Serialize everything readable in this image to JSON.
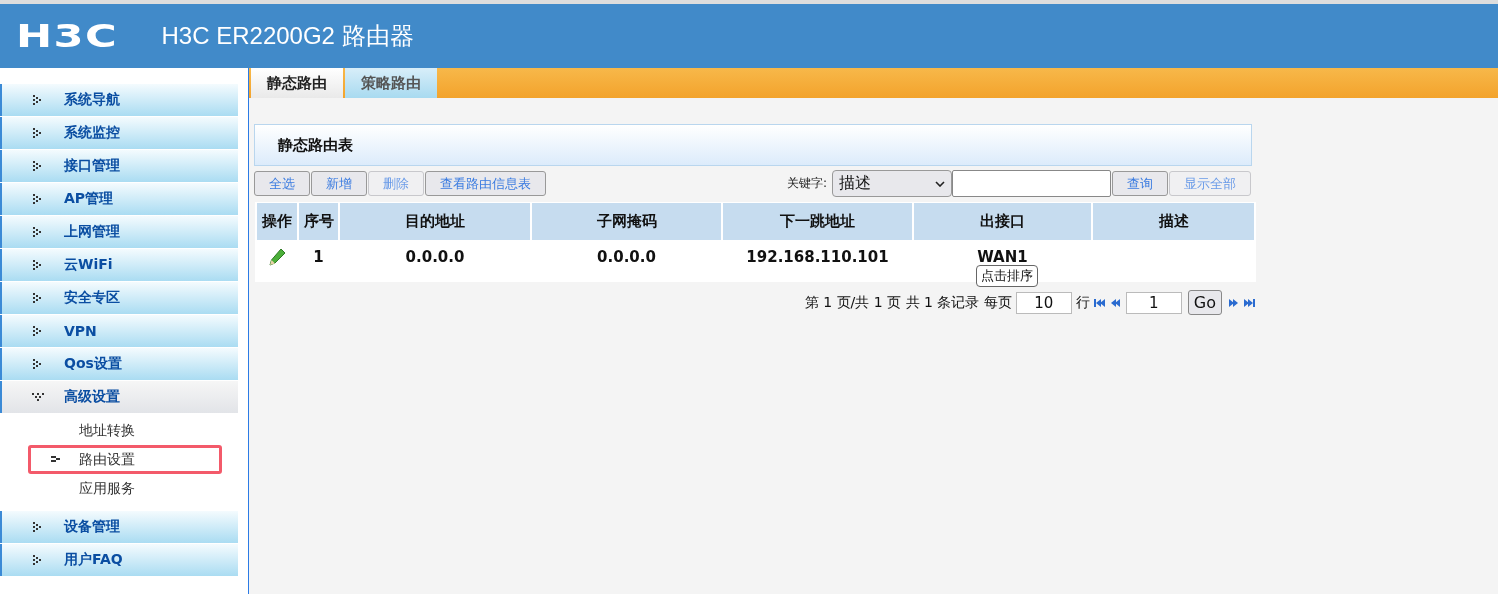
{
  "header": {
    "logo": "H3C",
    "title": "H3C ER2200G2 路由器"
  },
  "tabs": [
    {
      "label": "静态路由",
      "selected": true
    },
    {
      "label": "策略路由",
      "selected": false
    }
  ],
  "sidebar": {
    "items": [
      {
        "label": "系统导航",
        "expanded": false
      },
      {
        "label": "系统监控",
        "expanded": false
      },
      {
        "label": "接口管理",
        "expanded": false
      },
      {
        "label": "AP管理",
        "expanded": false
      },
      {
        "label": "上网管理",
        "expanded": false
      },
      {
        "label": "云WiFi",
        "expanded": false
      },
      {
        "label": "安全专区",
        "expanded": false
      },
      {
        "label": "VPN",
        "expanded": false
      },
      {
        "label": "Qos设置",
        "expanded": false
      },
      {
        "label": "高级设置",
        "expanded": true,
        "children": [
          {
            "label": "地址转换",
            "selected": false
          },
          {
            "label": "路由设置",
            "selected": true
          },
          {
            "label": "应用服务",
            "selected": false
          }
        ]
      },
      {
        "label": "设备管理",
        "expanded": false
      },
      {
        "label": "用户FAQ",
        "expanded": false
      }
    ]
  },
  "panel": {
    "title": "静态路由表",
    "buttons": [
      {
        "label": "全选",
        "disabled": false
      },
      {
        "label": "新增",
        "disabled": false
      },
      {
        "label": "删除",
        "disabled": true
      },
      {
        "label": "查看路由信息表",
        "disabled": false
      }
    ],
    "search": {
      "label": "关键字:",
      "select_value": "描述",
      "buttons": [
        {
          "label": "查询",
          "disabled": false
        },
        {
          "label": "显示全部",
          "disabled": true
        }
      ]
    },
    "table": {
      "columns": [
        "操作",
        "序号",
        "目的地址",
        "子网掩码",
        "下一跳地址",
        "出接口",
        "描述"
      ],
      "rows": [
        {
          "cells": [
            "",
            "1",
            "0.0.0.0",
            "0.0.0.0",
            "192.168.110.101",
            "WAN1"
          ]
        }
      ]
    },
    "tooltip": "点击排序",
    "pagination": {
      "summary": "第 1 页/共 1 页 共 1 条记录 每页",
      "per_page": "10",
      "unit": "行",
      "page": "1",
      "go": "Go"
    }
  }
}
